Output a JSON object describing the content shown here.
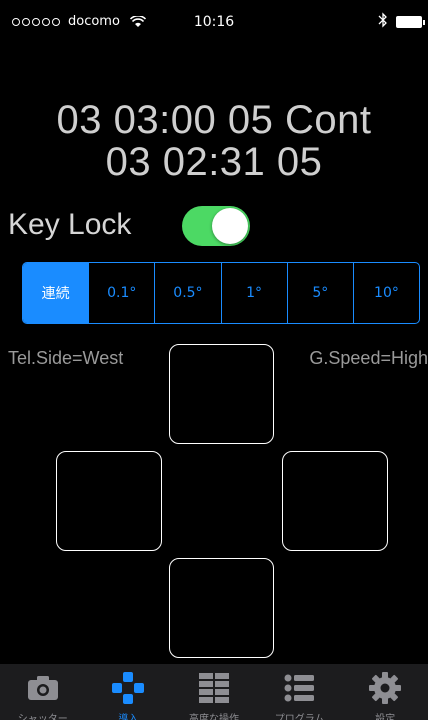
{
  "status_bar": {
    "carrier": "docomo",
    "time": "10:16"
  },
  "readout": {
    "line1": "03 03:00 05 Cont",
    "line2": "03 02:31 05"
  },
  "key_lock": {
    "label": "Key Lock",
    "on": true
  },
  "segments": [
    {
      "label": "連続",
      "selected": true
    },
    {
      "label": "0.1°",
      "selected": false
    },
    {
      "label": "0.5°",
      "selected": false
    },
    {
      "label": "1°",
      "selected": false
    },
    {
      "label": "5°",
      "selected": false
    },
    {
      "label": "10°",
      "selected": false
    }
  ],
  "labels": {
    "tel_side": "Tel.Side=West",
    "g_speed": "G.Speed=High"
  },
  "tabs": [
    {
      "label": "シャッター",
      "icon": "camera-icon",
      "active": false
    },
    {
      "label": "導入",
      "icon": "dpad-icon",
      "active": true
    },
    {
      "label": "高度な操作",
      "icon": "grid-icon",
      "active": false
    },
    {
      "label": "プログラム",
      "icon": "list-icon",
      "active": false
    },
    {
      "label": "設定",
      "icon": "gear-icon",
      "active": false
    }
  ],
  "colors": {
    "accent": "#1a8cff",
    "toggle_on": "#4cd964",
    "background": "#000000"
  }
}
